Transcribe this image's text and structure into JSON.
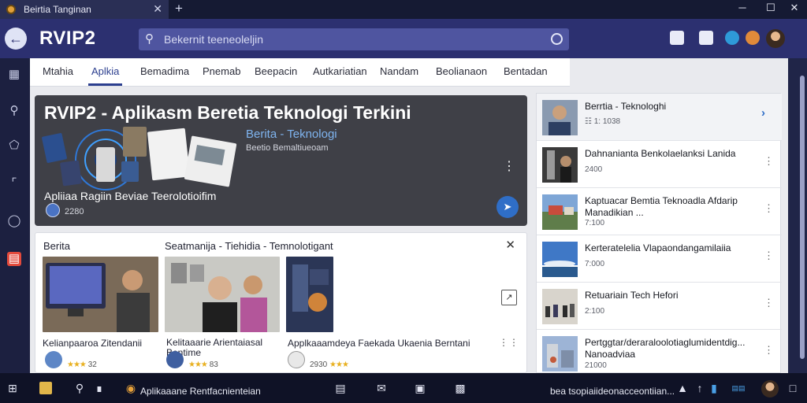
{
  "window": {
    "tab_title": "Beirtia Tanginan",
    "new_tab_label": "+",
    "minimize_label": "─",
    "maximize_label": "☐",
    "close_label": "✕"
  },
  "header": {
    "back_label": "←",
    "app_title": "RVIP2",
    "search_placeholder": "Bekernit teeneoleljin"
  },
  "nav": {
    "tabs": [
      {
        "label": "Mtahia"
      },
      {
        "label": "Aplkia"
      },
      {
        "label": "Bemadima"
      },
      {
        "label": "Pnemab"
      },
      {
        "label": "Beepacin"
      },
      {
        "label": "Autkariatian"
      },
      {
        "label": "Nandam"
      },
      {
        "label": "Beolianaon"
      },
      {
        "label": "Bentadan"
      }
    ],
    "active_index": 1
  },
  "hero": {
    "title": "RVIP2 - Aplikasm Beretia Teknologi Terkini",
    "subtitle": "Berita - Teknologi",
    "meta": "Beetio Bemaltiueoam",
    "caption": "Apliiaa Ragiin Beviae Teerolotioifim",
    "count": "2280"
  },
  "related": {
    "title": "Berita",
    "subtitle": "Seatmanija - Tiehidia - Temnolotigant",
    "items": [
      {
        "title": "Kelianpaaroa Zitendanii",
        "rating": 4,
        "meta": "32"
      },
      {
        "title": "Kelitaaarie Arientaiasal",
        "title2": "Bentime",
        "rating": 4,
        "meta": "83"
      },
      {
        "title": "Applkaaamdeya Faekada Ukaenia Berntani",
        "rating": 4,
        "meta": "2930"
      }
    ]
  },
  "sidebar_list": [
    {
      "title": "Berrtia - Teknologhi",
      "meta": "☷ 1: 1038"
    },
    {
      "title": "Dahnanianta Benkolaelanksi Lanida",
      "meta": "2400"
    },
    {
      "title": "Kaptuacar Bemtia Teknoadla Afdarip Manadikian ...",
      "meta": "7:100"
    },
    {
      "title": "Kerteratelelia Vlapaondangamilaiia",
      "meta": "7:000"
    },
    {
      "title": "Retuariain Tech Hefori",
      "meta": "2:100"
    },
    {
      "title": "Pertggtar/deraraloolotiaglumidentdig... Nanoadviaa",
      "meta": "21000"
    }
  ],
  "taskbar": {
    "app_label": "Aplikaaane Rentfacnienteian",
    "status_text": "bea tsopiaiideonacceontiian..."
  },
  "colors": {
    "header_bg": "#2c3070",
    "accent": "#2f6ec7",
    "active_tab": "#2c3f8f"
  }
}
